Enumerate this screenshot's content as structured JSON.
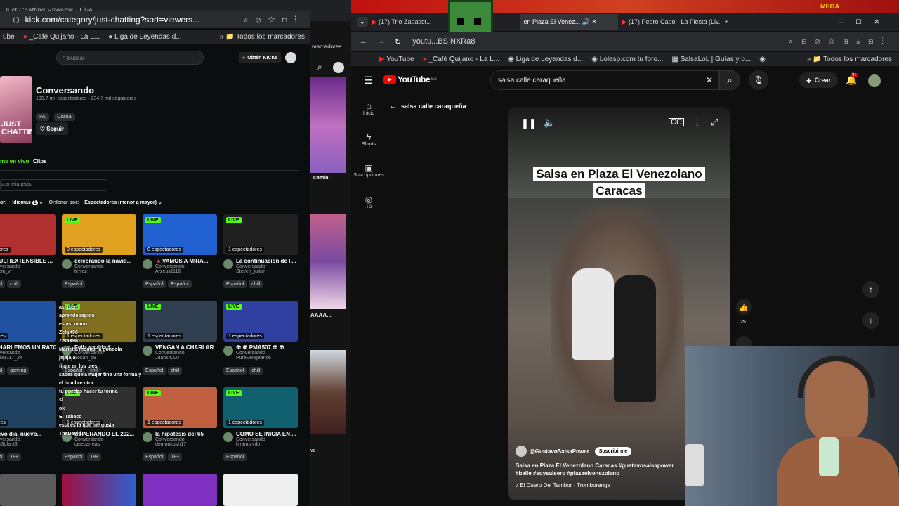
{
  "left_window": {
    "tab_title": "Just Chatting Streams - Live",
    "url": "kick.com/category/just-chatting?sort=viewers...",
    "bookmarks": [
      "ube",
      "_Café Quijano - La L...",
      "Liga de Leyendas d...",
      "Todos los marcadores"
    ],
    "search_placeholder": "Buscar",
    "get_kicks": "Obtén KICKs",
    "category_title": "Conversando",
    "category_stats": "199,7 mil espectadores · 234,7 mil seguidores",
    "category_tags": [
      "IRL",
      "Casual"
    ],
    "category_image_text": "JUST\nCHATTING",
    "follow_label": "Seguir",
    "tabs": [
      "ms en vivo",
      "Clips"
    ],
    "tag_search_placeholder": "scar etiquetas",
    "filter_prefix": "or:",
    "languages_label": "Idiomas",
    "languages_count": "1",
    "sort_label": "Ordenar por:",
    "sort_value": "Espectadores (menor a mayor)",
    "cards": [
      {
        "title": "MULTIEXTENSIBLE ...",
        "category": "onversando",
        "user": "olem_vr",
        "viewers": "ectadores",
        "tags": [
          "Español",
          "chill"
        ],
        "live": false,
        "bg": "#b03030"
      },
      {
        "title": "celebrando la navid...",
        "category": "Conversando",
        "user": "terrez",
        "viewers": "0 espectadores",
        "tags": [
          "Español"
        ],
        "live": true,
        "bg": "#e0a020"
      },
      {
        "title": "🔺VAMOS A MIRA...",
        "category": "Conversando",
        "user": "Arzeus1116",
        "viewers": "0 espectadores",
        "tags": [
          "Español",
          "Español"
        ],
        "live": true,
        "bg": "#2060d0"
      },
      {
        "title": "La continuacion de F...",
        "category": "Conversando",
        "user": "Steven_julian",
        "viewers": "1 espectadores",
        "tags": [
          "Español",
          "chill"
        ],
        "live": true,
        "bg": "#202020"
      },
      {
        "title": "CHARLEMOS UN RATO",
        "category": "onversando",
        "user": "ekker117_24",
        "viewers": "ctadores",
        "tags": [
          "Español",
          "gaming"
        ],
        "live": false,
        "bg": "#2050a0"
      },
      {
        "title": "Feliz navidad",
        "category": "Conversando",
        "user": "Yosan_d8",
        "viewers": "1 espectadores",
        "tags": [
          "Español",
          "chill"
        ],
        "live": true,
        "bg": "#807020"
      },
      {
        "title": "VENGAN A CHARLAR",
        "category": "Conversando",
        "user": "Juansit000",
        "viewers": "1 espectadores",
        "tags": [
          "Español",
          "chill"
        ],
        "live": true,
        "bg": "#304050"
      },
      {
        "title": "☢ ☢ PMA507 ☢ ☢",
        "category": "Conversando",
        "user": "PureVengeance",
        "viewers": "1 espectadores",
        "tags": [
          "Español",
          "chill"
        ],
        "live": true,
        "bg": "#3040a0"
      },
      {
        "title": "uevo dia, nuevo...",
        "category": "onversando",
        "user": "0m3dlant3",
        "viewers": "ctadores",
        "tags": [
          "Español",
          "18+"
        ],
        "live": false,
        "bg": "#204060"
      },
      {
        "title": "ESPERANDO EL 202...",
        "category": "Conversando",
        "user": "cinecarreas",
        "viewers": "1 espectadores",
        "tags": [
          "Español",
          "18+"
        ],
        "live": true,
        "bg": "#303030"
      },
      {
        "title": "la hipotesis del 65",
        "category": "Conversando",
        "user": "demonkush17",
        "viewers": "1 espectadores",
        "tags": [
          "Español",
          "18+"
        ],
        "live": true,
        "bg": "#c06040"
      },
      {
        "title": "COMO SE INICIA EN ...",
        "category": "Conversando",
        "user": "hiramshido",
        "viewers": "1 espectadores",
        "tags": [
          "Español"
        ],
        "live": true,
        "bg": "#106070"
      }
    ],
    "chat_overlay": [
      "así bien",
      "aprende rapido",
      "es asi mano",
      "ZetaX96",
      "ZetaX96",
      "Marietta montar la gondola",
      "jajajaja",
      "fijate en los pies",
      "sabes quela mujer tine una forma y",
      "el hombre otra",
      "tu puedes hacer tu forma",
      "si",
      "ok",
      "El Tabaco",
      "esta es la que me gusta",
      "TheDavidTv"
    ]
  },
  "middle_window": {
    "bookmark": "marcadores",
    "card_text": "Camin...",
    "bottom_text": "AAAA...",
    "small_text": "vo"
  },
  "right_window": {
    "tabs": [
      {
        "title": "(17) Trio Zapatist...",
        "active": false
      },
      {
        "title": "en Plaza El Venez...",
        "active": true
      },
      {
        "title": "(17) Pedro Capó - La Fiesta (Liv...",
        "active": false
      }
    ],
    "url": "youtu...BSINXRa8",
    "bookmarks": [
      "YouTube",
      "_Café Quijano - La L...",
      "Liga de Leyendas d...",
      "Lolesp.com tu foro...",
      "SalsaLoL | Guías y b...",
      "Todos los marcadores"
    ],
    "youtube": {
      "logo": "YouTube",
      "country": "ES",
      "search_value": "salsa calle caraqueña",
      "create_label": "Crear",
      "notif_count": "9+",
      "back_label": "salsa calle caraqueña",
      "sidebar": [
        "Inicio",
        "Shorts",
        "Suscripciones",
        "Tú"
      ]
    },
    "short": {
      "overlay_title_1": "Salsa en Plaza El Venezolano",
      "overlay_title_2": "Caracas",
      "channel": "@GustavoSalsaPower",
      "subscribe_label": "Suscribirme",
      "description": "Salsa en Plaza El Venezolano Caracas #gustavosalsapower #baile #soysalsero #plazaelvenezolano",
      "music": "El Cuero Del Tambor · Tromboranga",
      "likes": "25"
    },
    "top_overlay_label": "MEGA"
  }
}
